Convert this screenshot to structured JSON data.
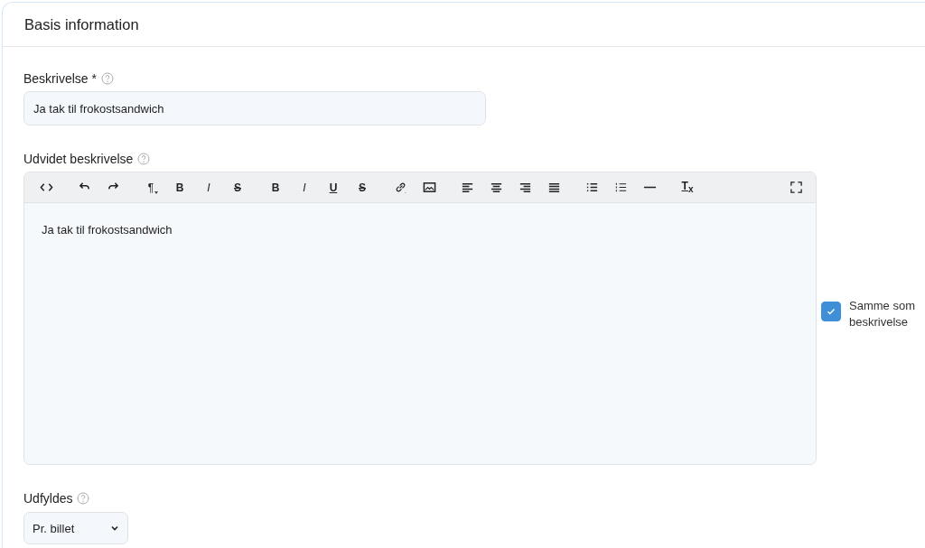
{
  "card": {
    "title": "Basis information"
  },
  "description": {
    "label": "Beskrivelse *",
    "value": "Ja tak til frokostsandwich"
  },
  "extended": {
    "label": "Udvidet beskrivelse",
    "content": "Ja tak til frokostsandwich",
    "toolbar": [
      [
        {
          "kind": "code"
        }
      ],
      [
        {
          "kind": "undo"
        },
        {
          "kind": "redo"
        }
      ],
      [
        {
          "kind": "paragraph",
          "label": "¶"
        },
        {
          "kind": "bold",
          "label": "B"
        },
        {
          "kind": "italic",
          "label": "I"
        },
        {
          "kind": "strike",
          "label": "S"
        }
      ],
      [
        {
          "kind": "bold",
          "label": "B"
        },
        {
          "kind": "italic",
          "label": "I"
        },
        {
          "kind": "underline",
          "label": "U"
        },
        {
          "kind": "strike",
          "label": "S"
        }
      ],
      [
        {
          "kind": "link"
        },
        {
          "kind": "image"
        }
      ],
      [
        {
          "kind": "align-left"
        },
        {
          "kind": "align-center"
        },
        {
          "kind": "align-right"
        },
        {
          "kind": "justify"
        }
      ],
      [
        {
          "kind": "bullets"
        },
        {
          "kind": "numbers"
        },
        {
          "kind": "rule"
        }
      ],
      [
        {
          "kind": "clear",
          "label": "T$_{x}$"
        }
      ],
      [
        {
          "kind": "fullscreen"
        }
      ]
    ],
    "same": {
      "label": "Samme som beskrivelse",
      "checked": true
    }
  },
  "fill": {
    "label": "Udfyldes",
    "value": "Pr. billet"
  }
}
